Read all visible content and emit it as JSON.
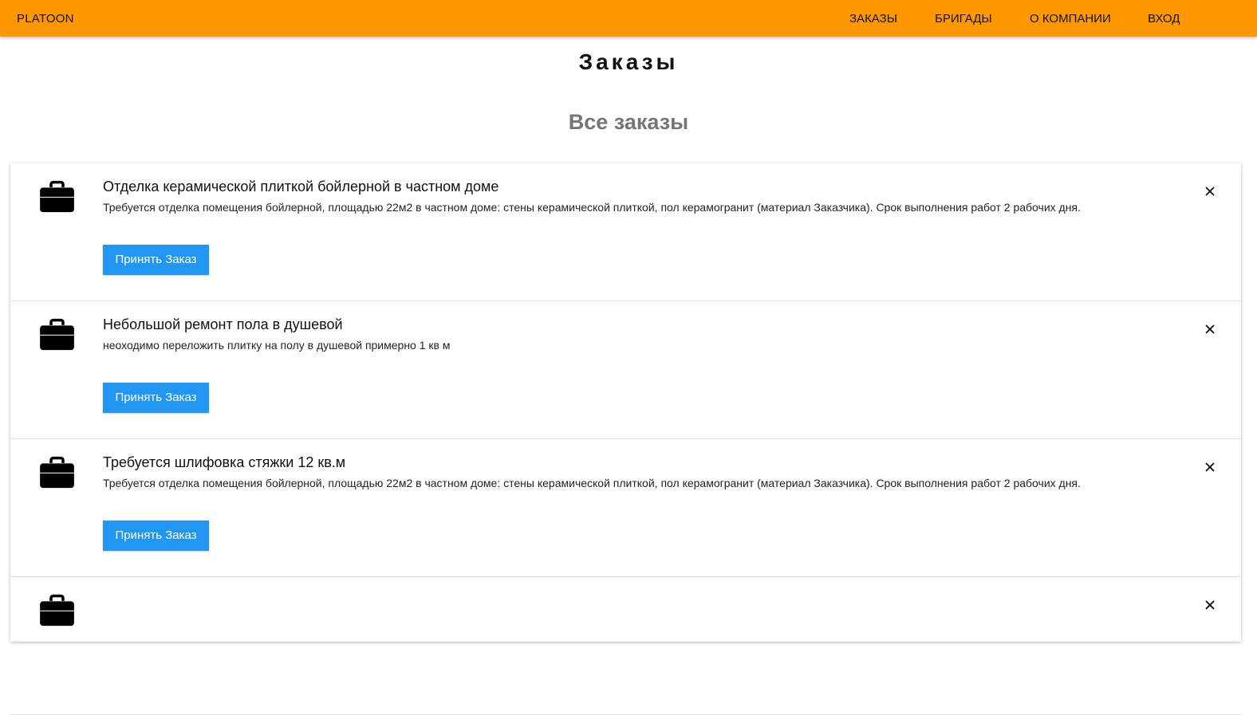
{
  "brand": "PLATOON",
  "nav": {
    "orders": "ЗАКАЗЫ",
    "brigades": "БРИГАДЫ",
    "about": "О КОМПАНИИ",
    "login": "ВХОД"
  },
  "page": {
    "title": "Заказы",
    "subtitle": "Все заказы"
  },
  "orders": [
    {
      "title": "Отделка керамической плиткой бойлерной в частном доме",
      "description": "Требуется отделка помещения бойлерной, площадью 22м2 в частном доме: стены керамической плиткой, пол керамогранит (материал Заказчика). Срок выполнения работ 2 рабочих дня.",
      "button": "Принять Заказ"
    },
    {
      "title": "Небольшой ремонт пола в душевой",
      "description": "неоходимо переложить плитку на полу в душевой примерно 1 кв м",
      "button": "Принять Заказ"
    },
    {
      "title": "Требуется шлифовка стяжки 12 кв.м",
      "description": "Требуется отделка помещения бойлерной, площадью 22м2 в частном доме: стены керамической плиткой, пол керамогранит (материал Заказчика). Срок выполнения работ 2 рабочих дня.",
      "button": "Принять Заказ"
    },
    {
      "title": "",
      "description": "",
      "button": ""
    }
  ],
  "colors": {
    "navbar": "#ff9800",
    "button": "#2196f3",
    "subtitle": "#757575"
  },
  "icons": {
    "order": "briefcase-icon",
    "remove": "close-icon"
  }
}
